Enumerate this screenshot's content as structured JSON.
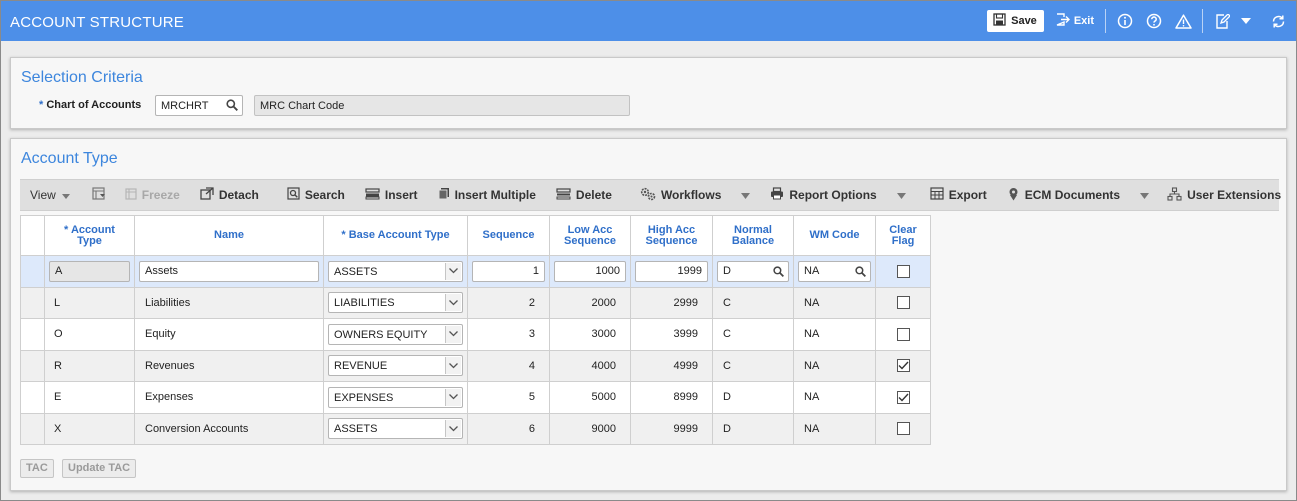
{
  "header": {
    "title": "ACCOUNT STRUCTURE",
    "save_label": "Save",
    "exit_label": "Exit"
  },
  "selection_criteria": {
    "title": "Selection Criteria",
    "required_mark": "*",
    "chart_label": "Chart of Accounts",
    "chart_value": "MRCHRT",
    "chart_description": "MRC Chart Code"
  },
  "account_type": {
    "title": "Account Type",
    "toolbar": {
      "view": "View",
      "freeze": "Freeze",
      "detach": "Detach",
      "search": "Search",
      "insert": "Insert",
      "insert_multiple": "Insert Multiple",
      "delete": "Delete",
      "workflows": "Workflows",
      "report_options": "Report Options",
      "export": "Export",
      "ecm_documents": "ECM Documents",
      "user_extensions": "User Extensions"
    },
    "columns": {
      "account_type": [
        "* Account",
        "Type"
      ],
      "name": "Name",
      "base_account_type": "* Base Account Type",
      "sequence": "Sequence",
      "low_acc": [
        "Low Acc",
        "Sequence"
      ],
      "high_acc": [
        "High Acc",
        "Sequence"
      ],
      "normal_balance": [
        "Normal",
        "Balance"
      ],
      "wm_code": "WM Code",
      "clear_flag": [
        "Clear",
        "Flag"
      ]
    },
    "rows": [
      {
        "account_type": "A",
        "name": "Assets",
        "base": "ASSETS",
        "sequence": "1",
        "low": "1000",
        "high": "1999",
        "normal": "D",
        "wm": "NA",
        "clear": false
      },
      {
        "account_type": "L",
        "name": "Liabilities",
        "base": "LIABILITIES",
        "sequence": "2",
        "low": "2000",
        "high": "2999",
        "normal": "C",
        "wm": "NA",
        "clear": false
      },
      {
        "account_type": "O",
        "name": "Equity",
        "base": "OWNERS EQUITY",
        "sequence": "3",
        "low": "3000",
        "high": "3999",
        "normal": "C",
        "wm": "NA",
        "clear": false
      },
      {
        "account_type": "R",
        "name": "Revenues",
        "base": "REVENUE",
        "sequence": "4",
        "low": "4000",
        "high": "4999",
        "normal": "C",
        "wm": "NA",
        "clear": true
      },
      {
        "account_type": "E",
        "name": "Expenses",
        "base": "EXPENSES",
        "sequence": "5",
        "low": "5000",
        "high": "8999",
        "normal": "D",
        "wm": "NA",
        "clear": true
      },
      {
        "account_type": "X",
        "name": "Conversion Accounts",
        "base": "ASSETS",
        "sequence": "6",
        "low": "9000",
        "high": "9999",
        "normal": "D",
        "wm": "NA",
        "clear": false
      }
    ],
    "buttons": {
      "tac": "TAC",
      "update_tac": "Update TAC"
    }
  },
  "colors": {
    "header_bg": "#4d8fe8",
    "title_blue": "#3d86dd",
    "column_header": "#2f6fc9",
    "selected_row": "#dde9fb"
  }
}
